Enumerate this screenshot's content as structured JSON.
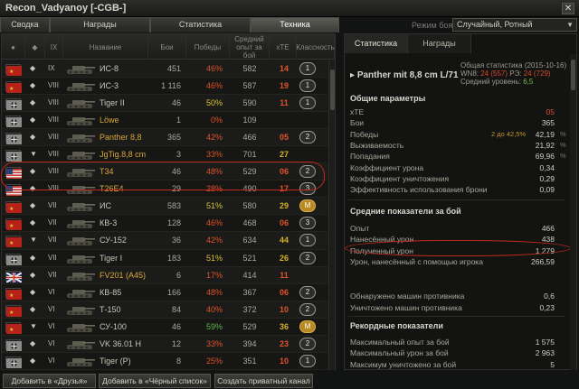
{
  "window": {
    "title": "Recon_Vadyanoy [-CGB-]"
  },
  "tabs": [
    "Сводка",
    "Награды",
    "Статистика",
    "Техника"
  ],
  "mode": {
    "label": "Режим боя:",
    "value": "Случайный, Ротный"
  },
  "table": {
    "headers": [
      "Название",
      "Бои",
      "Победы",
      "Средний опыт за бой",
      "хТЕ",
      "Классность"
    ],
    "rows": [
      {
        "nation": "ussr",
        "cls": "◆",
        "tier": "IX",
        "name": "ИС-8",
        "battles": "451",
        "wins": "46%",
        "win_color": "#e0532b",
        "xp": "582",
        "xte": "14",
        "xte_color": "#e0532b",
        "mastery": "1"
      },
      {
        "nation": "ussr",
        "cls": "◆",
        "tier": "VIII",
        "name": "ИС-3",
        "battles": "1 116",
        "wins": "46%",
        "win_color": "#e0532b",
        "xp": "587",
        "xte": "19",
        "xte_color": "#e0532b",
        "mastery": "1"
      },
      {
        "nation": "germany",
        "cls": "◆",
        "tier": "VIII",
        "name": "Tiger II",
        "battles": "46",
        "wins": "50%",
        "win_color": "#d8c23a",
        "xp": "590",
        "xte": "11",
        "xte_color": "#e0532b",
        "mastery": "1"
      },
      {
        "nation": "germany",
        "cls": "◆",
        "tier": "VIII",
        "name": "Löwe",
        "battles": "1",
        "wins": "0%",
        "win_color": "#e0532b",
        "xp": "109",
        "xte": "",
        "xte_color": "#e0532b",
        "mastery": "",
        "premium": true
      },
      {
        "nation": "germany",
        "cls": "◆",
        "tier": "VIII",
        "name": "Panther 8,8",
        "battles": "365",
        "wins": "42%",
        "win_color": "#e0532b",
        "xp": "466",
        "xte": "05",
        "xte_color": "#e0532b",
        "mastery": "2",
        "premium": true
      },
      {
        "nation": "germany",
        "cls": "▼",
        "tier": "VIII",
        "name": "JgTig.8,8 cm",
        "battles": "3",
        "wins": "33%",
        "win_color": "#e0532b",
        "xp": "701",
        "xte": "27",
        "xte_color": "#d4b02b",
        "mastery": "",
        "premium": true
      },
      {
        "nation": "usa",
        "cls": "◆",
        "tier": "VIII",
        "name": "T34",
        "battles": "46",
        "wins": "48%",
        "win_color": "#e0532b",
        "xp": "529",
        "xte": "06",
        "xte_color": "#e0532b",
        "mastery": "2",
        "premium": true
      },
      {
        "nation": "usa",
        "cls": "◆",
        "tier": "VIII",
        "name": "T26E4",
        "battles": "29",
        "wins": "28%",
        "win_color": "#e0532b",
        "xp": "490",
        "xte": "17",
        "xte_color": "#e0532b",
        "mastery": "3",
        "premium": true
      },
      {
        "nation": "ussr",
        "cls": "◆",
        "tier": "VII",
        "name": "ИС",
        "battles": "583",
        "wins": "51%",
        "win_color": "#d8c23a",
        "xp": "580",
        "xte": "29",
        "xte_color": "#d4b02b",
        "mastery": "M"
      },
      {
        "nation": "ussr",
        "cls": "◆",
        "tier": "VII",
        "name": "КВ-3",
        "battles": "128",
        "wins": "46%",
        "win_color": "#e0532b",
        "xp": "468",
        "xte": "06",
        "xte_color": "#e0532b",
        "mastery": "3"
      },
      {
        "nation": "ussr",
        "cls": "▼",
        "tier": "VII",
        "name": "СУ-152",
        "battles": "36",
        "wins": "42%",
        "win_color": "#e0532b",
        "xp": "634",
        "xte": "44",
        "xte_color": "#d4b02b",
        "mastery": "1"
      },
      {
        "nation": "germany",
        "cls": "◆",
        "tier": "VII",
        "name": "Tiger I",
        "battles": "183",
        "wins": "51%",
        "win_color": "#d8c23a",
        "xp": "521",
        "xte": "26",
        "xte_color": "#d4b02b",
        "mastery": "2"
      },
      {
        "nation": "uk",
        "cls": "◆",
        "tier": "VII",
        "name": "FV201 (A45)",
        "battles": "6",
        "wins": "17%",
        "win_color": "#e0532b",
        "xp": "414",
        "xte": "11",
        "xte_color": "#e0532b",
        "mastery": "",
        "premium": true
      },
      {
        "nation": "ussr",
        "cls": "◆",
        "tier": "VI",
        "name": "КВ-85",
        "battles": "166",
        "wins": "48%",
        "win_color": "#e0532b",
        "xp": "367",
        "xte": "06",
        "xte_color": "#e0532b",
        "mastery": "2"
      },
      {
        "nation": "ussr",
        "cls": "◆",
        "tier": "VI",
        "name": "Т-150",
        "battles": "84",
        "wins": "40%",
        "win_color": "#e0532b",
        "xp": "372",
        "xte": "10",
        "xte_color": "#e0532b",
        "mastery": "2"
      },
      {
        "nation": "ussr",
        "cls": "▼",
        "tier": "VI",
        "name": "СУ-100",
        "battles": "46",
        "wins": "59%",
        "win_color": "#5cb84a",
        "xp": "529",
        "xte": "36",
        "xte_color": "#d4b02b",
        "mastery": "M"
      },
      {
        "nation": "germany",
        "cls": "◆",
        "tier": "VI",
        "name": "VK 36.01 H",
        "battles": "12",
        "wins": "33%",
        "win_color": "#e0532b",
        "xp": "394",
        "xte": "23",
        "xte_color": "#e0532b",
        "mastery": "2"
      },
      {
        "nation": "germany",
        "cls": "◆",
        "tier": "VI",
        "name": "Tiger (P)",
        "battles": "8",
        "wins": "25%",
        "win_color": "#e0532b",
        "xp": "351",
        "xte": "10",
        "xte_color": "#e0532b",
        "mastery": "1"
      }
    ]
  },
  "right": {
    "tabs": [
      "Статистика",
      "Награды"
    ],
    "vehicle": "Panther mit 8,8 cm L/71",
    "general": {
      "line1": "Общая статистика (2015-10-16)",
      "line2a": "WN8: ",
      "line2b": "24 (557)",
      "line2c": " РЭ: ",
      "line2d": "24 (729)",
      "line3a": "Средний уровень: ",
      "line3b": "6,5"
    },
    "sections": {
      "general": "Общие параметры",
      "avg": "Средние показатели за бой",
      "records": "Рекордные показатели"
    },
    "stats_general": [
      {
        "label": "хТЕ",
        "value": "05",
        "red": true
      },
      {
        "label": "Бои",
        "value": "365"
      },
      {
        "label": "Победы",
        "value": "42,19",
        "extra": "2 до 42,5%",
        "pct": "%"
      },
      {
        "label": "Выживаемость",
        "value": "21,92",
        "pct": "%"
      },
      {
        "label": "Попадания",
        "value": "69,96",
        "pct": "%"
      },
      {
        "label": "Коэффициент урона",
        "value": "0,34"
      },
      {
        "label": "Коэффициент уничтожения",
        "value": "0,29"
      },
      {
        "label": "Эффективность использования брони",
        "value": "0,09"
      }
    ],
    "stats_avg": [
      {
        "label": "Опыт",
        "value": "466"
      },
      {
        "label": "Нанесённый урон",
        "value": "438"
      },
      {
        "label": "Полученный урон",
        "value": "1 279"
      },
      {
        "label": "Урон, нанесённый с помощью игрока",
        "value": "266,59"
      },
      {
        "label": "Обнаружено машин противника",
        "value": "0,6"
      },
      {
        "label": "Уничтожено машин противника",
        "value": "0,23"
      }
    ],
    "stats_records": [
      {
        "label": "Максимальный опыт за бой",
        "value": "1 575"
      },
      {
        "label": "Максимальный урон за бой",
        "value": "2 963"
      },
      {
        "label": "Максимум уничтожено за бой",
        "value": "5"
      }
    ]
  },
  "buttons": {
    "friends": "Добавить в «Друзья»",
    "blacklist": "Добавить в «Чёрный список»",
    "channel": "Создать приватный канал"
  }
}
